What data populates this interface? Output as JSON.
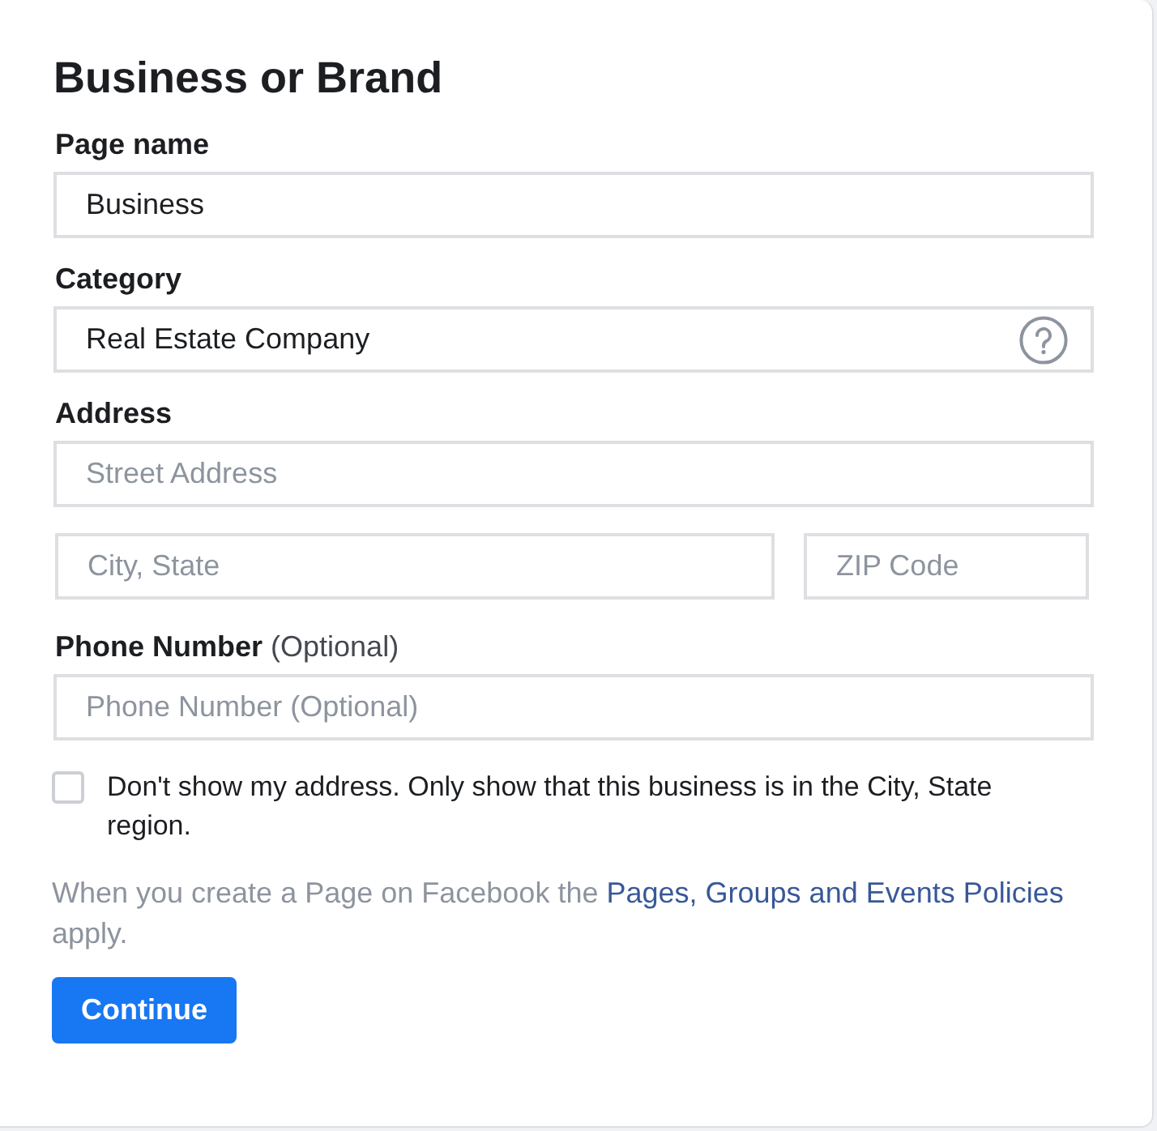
{
  "title": "Business or Brand",
  "fields": [
    {
      "label": "Page name",
      "rows": [
        [
          {
            "kind": "text",
            "value": "Business"
          }
        ]
      ]
    },
    {
      "label": "Category",
      "rows": [
        [
          {
            "kind": "help",
            "value": "Real Estate Company"
          }
        ]
      ]
    },
    {
      "label": "Address",
      "rows": [
        [
          {
            "kind": "text",
            "placeholder": "Street Address"
          }
        ],
        [
          {
            "kind": "text",
            "placeholder": "City, State"
          },
          {
            "kind": "text",
            "placeholder": "ZIP Code"
          }
        ]
      ]
    },
    {
      "label": "Phone Number",
      "note": "(Optional)",
      "rows": [
        [
          {
            "kind": "text",
            "placeholder": "Phone Number (Optional)"
          }
        ]
      ]
    }
  ],
  "hide_address": {
    "checked": false,
    "label": "Don't show my address. Only show that this business is in the City, State region."
  },
  "policy": {
    "text": "When you create a Page on Facebook the",
    "link": "Pages, Groups and Events Policies",
    "after": "apply."
  },
  "continue_button": {
    "label": "Continue"
  }
}
